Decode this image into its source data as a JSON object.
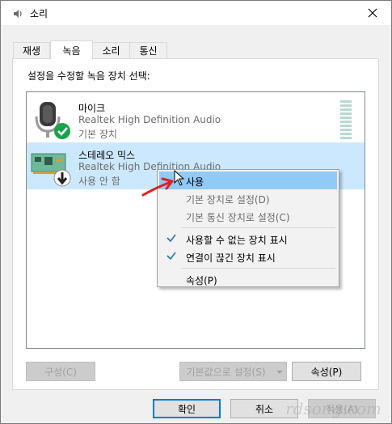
{
  "window": {
    "title": "소리"
  },
  "tabs": [
    {
      "label": "재생",
      "active": false
    },
    {
      "label": "녹음",
      "active": true
    },
    {
      "label": "소리",
      "active": false
    },
    {
      "label": "통신",
      "active": false
    }
  ],
  "panel": {
    "instruction": "설정을 수정할 녹음 장치 선택:"
  },
  "devices": [
    {
      "name": "마이크",
      "description": "Realtek High Definition Audio",
      "status": "기본 장치",
      "icon": "microphone-icon",
      "badge": "default-check-badge-icon",
      "selected": false
    },
    {
      "name": "스테레오 믹스",
      "description": "Realtek High Definition Audio",
      "status": "사용 안 함",
      "icon": "sound-card-icon",
      "badge": "disabled-arrow-badge-icon",
      "selected": true
    }
  ],
  "context_menu": {
    "items": [
      {
        "label": "사용",
        "state": "hover",
        "checked": false
      },
      {
        "label": "기본 장치로 설정(D)",
        "state": "disabled",
        "checked": false
      },
      {
        "label": "기본 통신 장치로 설정(C)",
        "state": "disabled",
        "checked": false
      },
      {
        "label": "사용할 수 없는 장치 표시",
        "state": "normal",
        "checked": true
      },
      {
        "label": "연결이 끊긴 장치 표시",
        "state": "normal",
        "checked": true
      },
      {
        "label": "속성(P)",
        "state": "normal",
        "checked": false
      }
    ]
  },
  "buttons": {
    "configure": "구성(C)",
    "set_default": "기본값으로 설정(S)",
    "properties": "속성(P)",
    "ok": "확인",
    "cancel": "취소",
    "apply": "적용(A)"
  },
  "watermark": "rdsong.com",
  "colors": {
    "accent": "#0078d7",
    "selection": "#cce8ff",
    "menu_hover": "#91c9f7",
    "default_check": "#1aa34a",
    "annotation_arrow": "#e02020"
  }
}
